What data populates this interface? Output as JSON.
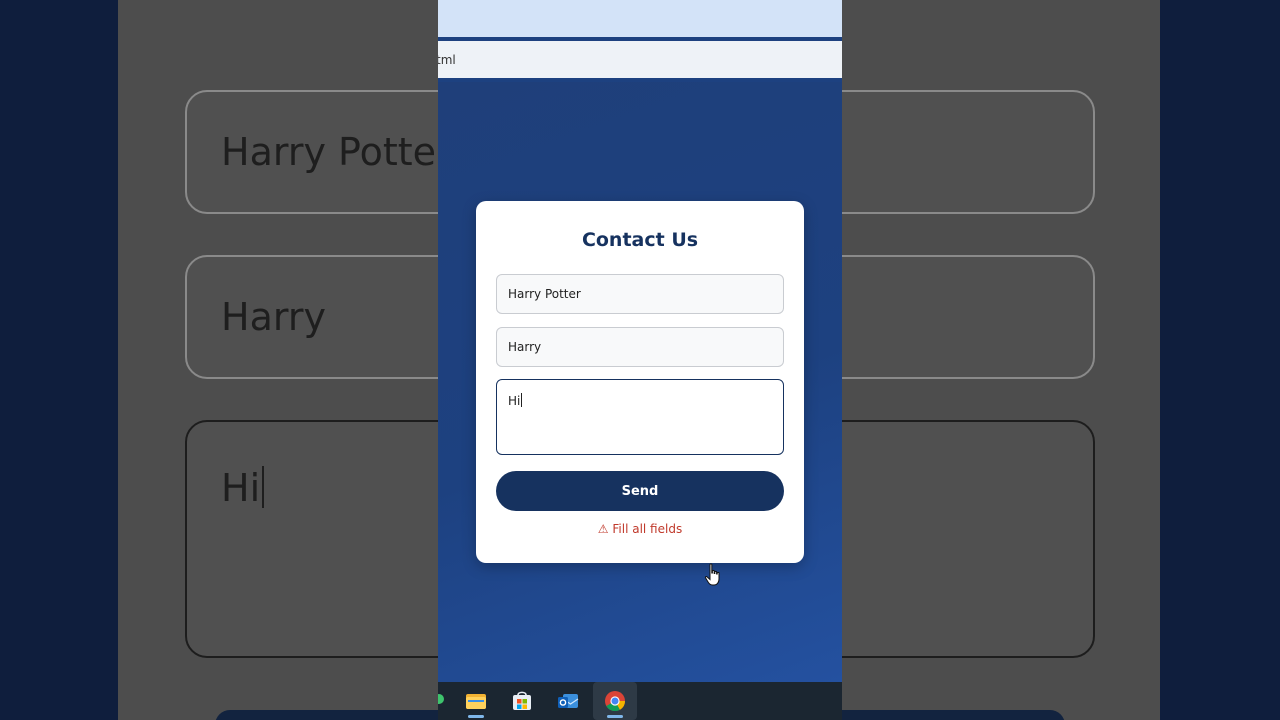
{
  "background": {
    "name_value": "Harry Potter",
    "email_value": "Harry",
    "message_value": "Hi"
  },
  "browser": {
    "address_text": "tml"
  },
  "form": {
    "title": "Contact Us",
    "name_value": "Harry Potter",
    "email_value": "Harry",
    "message_value": "Hi",
    "send_label": "Send",
    "error_text": "⚠ Fill all fields"
  },
  "taskbar": {
    "icons": [
      "file-explorer-icon",
      "microsoft-store-icon",
      "outlook-icon",
      "chrome-icon"
    ],
    "active": "chrome-icon"
  },
  "colors": {
    "page_background": "#1d4180",
    "accent": "#16325f",
    "error": "#c0392b",
    "card": "#ffffff"
  }
}
